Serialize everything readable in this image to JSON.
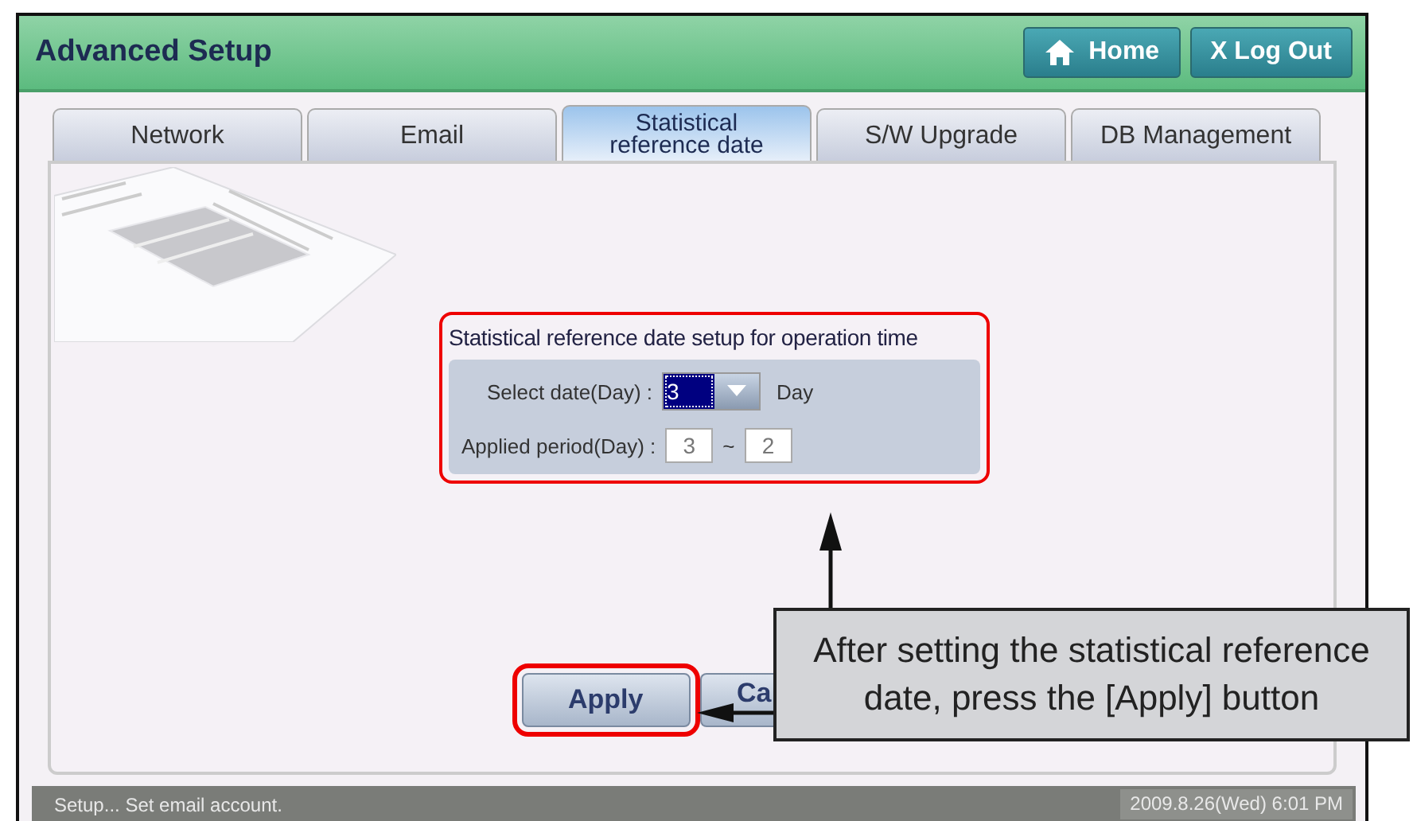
{
  "window": {
    "title": "Advanced Setup"
  },
  "header_buttons": [
    {
      "kind": "home",
      "label": "Home"
    },
    {
      "kind": "plain",
      "label": "X Log Out"
    }
  ],
  "tabs": [
    {
      "label": "Network",
      "selected": false
    },
    {
      "label": "Email",
      "selected": false
    },
    {
      "label": "Statistical reference date",
      "selected": true
    },
    {
      "label": "S/W Upgrade",
      "selected": false
    },
    {
      "label": "DB Management",
      "selected": false
    }
  ],
  "group": {
    "title": "Statistical reference date setup for operation time",
    "highlighted": true,
    "select_date": {
      "label": "Select date(Day) :",
      "value": "3",
      "selected": true,
      "unit": "Day"
    },
    "applied_period": {
      "label": "Applied period(Day) :",
      "from": "3",
      "separator": "~",
      "to": "2"
    }
  },
  "buttons": [
    {
      "label": "Apply",
      "highlighted": true
    },
    {
      "label": "Ca",
      "highlighted": false
    }
  ],
  "callout": {
    "text": "After setting the statistical reference date, press the [Apply] button"
  },
  "status_bar": {
    "message": "Setup... Set email account.",
    "datetime": "2009.8.26(Wed)  6:01 PM"
  }
}
